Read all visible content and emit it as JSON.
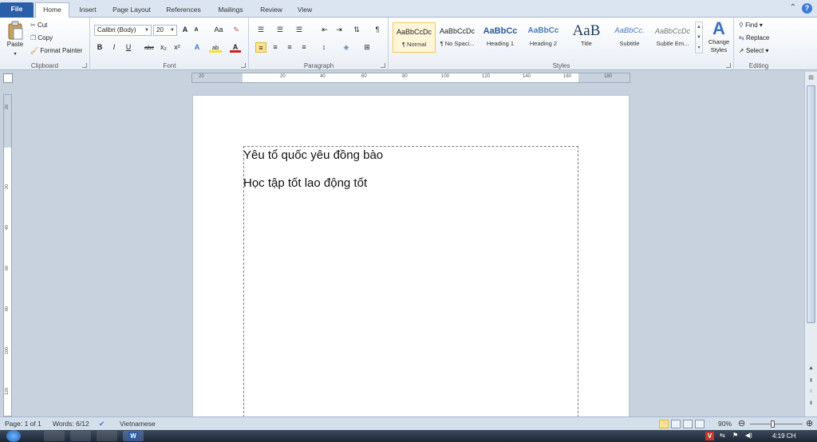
{
  "tabs": [
    "File",
    "Home",
    "Insert",
    "Page Layout",
    "References",
    "Mailings",
    "Review",
    "View"
  ],
  "ribbon": {
    "clipboard": {
      "label": "Clipboard",
      "paste": "Paste",
      "cut": "Cut",
      "copy": "Copy",
      "format_painter": "Format Painter"
    },
    "font": {
      "label": "Font",
      "font_name": "Calibri (Body)",
      "font_size": "20",
      "grow": "A",
      "shrink": "A",
      "change_case": "Aa",
      "bold": "B",
      "italic": "I",
      "underline": "U",
      "strike": "abc",
      "subscript": "x₂",
      "superscript": "x²",
      "text_effects": "A",
      "highlight": "ab",
      "font_color": "A"
    },
    "paragraph": {
      "label": "Paragraph",
      "pilcrow": "¶"
    },
    "styles": {
      "label": "Styles",
      "items": [
        {
          "preview": "AaBbCcDc",
          "name": "¶ Normal"
        },
        {
          "preview": "AaBbCcDc",
          "name": "¶ No Spaci..."
        },
        {
          "preview": "AaBbCc",
          "name": "Heading 1"
        },
        {
          "preview": "AaBbCc",
          "name": "Heading 2"
        },
        {
          "preview": "AaB",
          "name": "Title"
        },
        {
          "preview": "AaBbCc.",
          "name": "Subtitle"
        },
        {
          "preview": "AaBbCcDc",
          "name": "Subtle Em..."
        }
      ],
      "change_styles": "Change Styles"
    },
    "editing": {
      "label": "Editing",
      "find": "Find",
      "replace": "Replace",
      "select": "Select"
    }
  },
  "ruler": {
    "h_ticks": [
      "20",
      "20",
      "40",
      "60",
      "80",
      "100",
      "120",
      "140",
      "160",
      "180"
    ],
    "v_ticks": [
      "20",
      "20",
      "40",
      "60",
      "80",
      "100",
      "120"
    ]
  },
  "document": {
    "line1": "Yêu tổ quốc yêu đồng bào",
    "line2": "Học tập tốt lao động tốt"
  },
  "status": {
    "page": "Page: 1 of 1",
    "words": "Words: 6/12",
    "language": "Vietnamese",
    "zoom": "90%"
  },
  "taskbar": {
    "time": "4:19 CH"
  },
  "colors": {
    "file_tab": "#2a5ea8",
    "ribbon_bg": "#e9eef5",
    "workspace": "#c8d2de",
    "accent": "#3a7bd5"
  }
}
